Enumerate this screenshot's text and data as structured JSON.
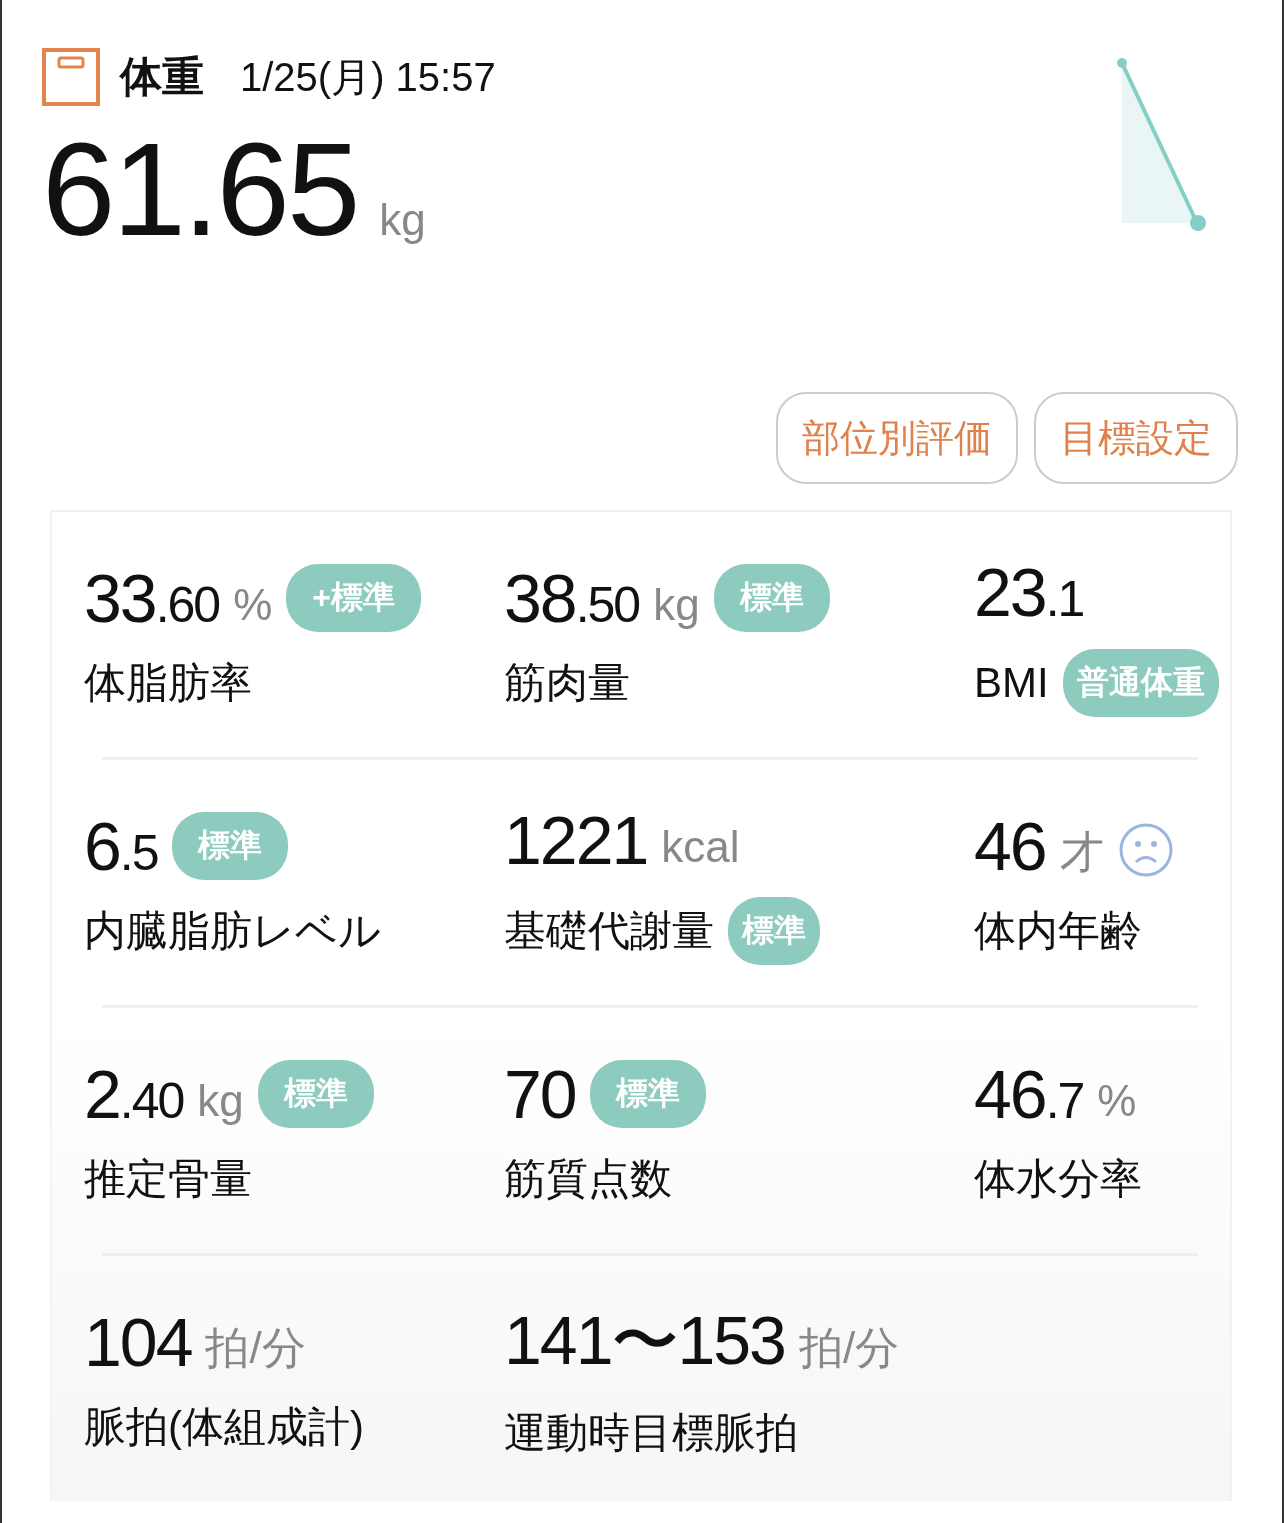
{
  "header": {
    "title": "体重",
    "datetime": "1/25(月) 15:57"
  },
  "weight": {
    "value": "61.65",
    "unit": "kg"
  },
  "buttons": [
    "部位別評価",
    "目標設定"
  ],
  "metric_rows": [
    {
      "items": [
        {
          "kind": "plain",
          "value": "33",
          "decimal": ".60",
          "unit": "%",
          "label": "体脂肪率",
          "value_badge": "+標準"
        },
        {
          "kind": "plain",
          "value": "38",
          "decimal": ".50",
          "unit": "kg",
          "label": "筋肉量",
          "value_badge": "標準"
        },
        {
          "kind": "plain",
          "value": "23",
          "decimal": ".1",
          "label": "BMI",
          "label_badge": "普通体重"
        }
      ]
    },
    {
      "items": [
        {
          "kind": "plain",
          "value": "6",
          "decimal": ".5",
          "label": "内臓脂肪レベル",
          "value_badge": "標準"
        },
        {
          "kind": "plain",
          "value": "1221",
          "unit": "kcal",
          "label": "基礎代謝量",
          "label_badge": "標準"
        },
        {
          "kind": "face",
          "value": "46",
          "unit": "才",
          "label": "体内年齢"
        }
      ]
    },
    {
      "items": [
        {
          "kind": "plain",
          "value": "2",
          "decimal": ".40",
          "unit": "kg",
          "label": "推定骨量",
          "value_badge": "標準"
        },
        {
          "kind": "plain",
          "value": "70",
          "label": "筋質点数",
          "value_badge": "標準"
        },
        {
          "kind": "plain",
          "value": "46",
          "decimal": ".7",
          "unit": "%",
          "label": "体水分率"
        }
      ]
    },
    {
      "items": [
        {
          "kind": "plain",
          "value": "104",
          "unit": "拍/分",
          "label": "脈拍(体組成計)"
        },
        {
          "kind": "plain",
          "value": "141〜153",
          "unit": "拍/分",
          "label": "運動時目標脈拍"
        }
      ]
    }
  ]
}
